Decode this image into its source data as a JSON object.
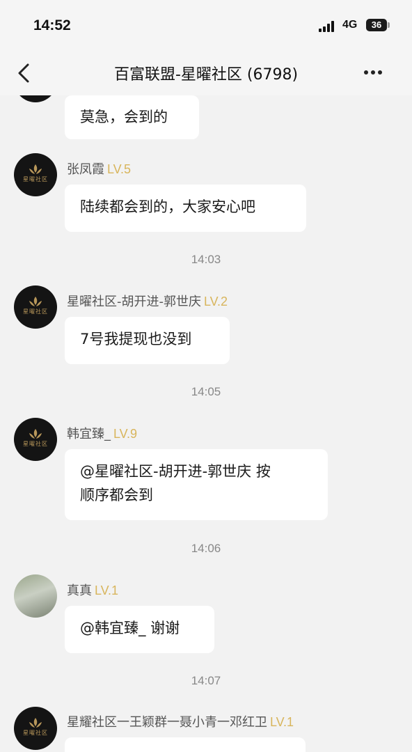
{
  "status_bar": {
    "time": "14:52",
    "network": "4G",
    "battery": "36"
  },
  "nav": {
    "title": "百富联盟-星曜社区 (6798)",
    "back_icon": "chevron-left-icon",
    "more_icon": "more-horizontal-icon"
  },
  "avatar_logo_text": "星曜社区",
  "messages": [
    {
      "text": "莫急，会到的"
    },
    {
      "sender": "张凤霞",
      "level": "LV.5",
      "text": "陆续都会到的，大家安心吧"
    },
    {
      "time": "14:03"
    },
    {
      "sender": "星曜社区-胡开进-郭世庆",
      "level": "LV.2",
      "text": "7号我提现也没到"
    },
    {
      "time": "14:05"
    },
    {
      "sender": "韩宜臻_",
      "level": "LV.9",
      "text_line1": "@星曜社区-胡开进-郭世庆 按",
      "text_line2": "顺序都会到"
    },
    {
      "time": "14:06"
    },
    {
      "sender": "真真",
      "level": "LV.1",
      "text": "@韩宜臻_ 谢谢"
    },
    {
      "time": "14:07"
    },
    {
      "sender": "星耀社区一王颖群一聂小青一邓红卫",
      "level": "LV.1"
    }
  ]
}
